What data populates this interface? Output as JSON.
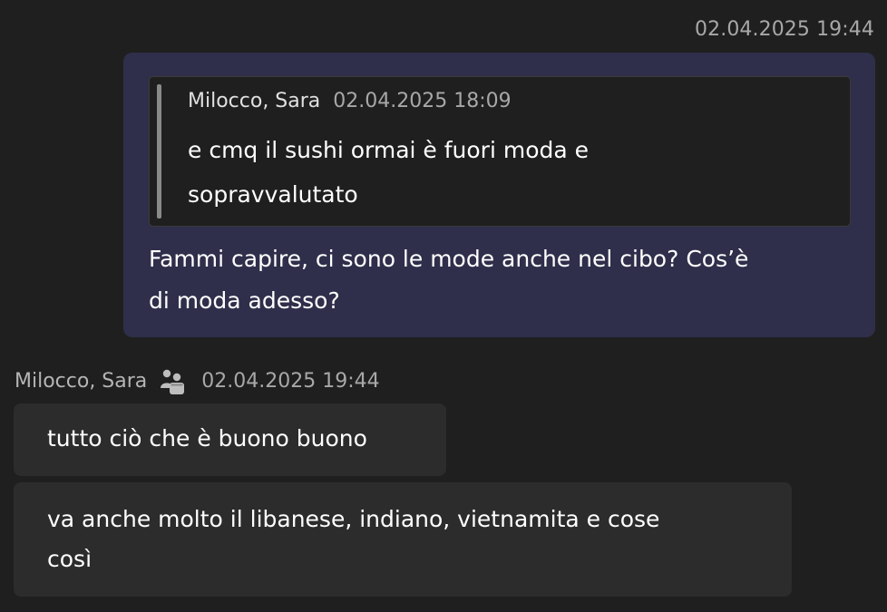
{
  "sent_message": {
    "timestamp": "02.04.2025 19:44",
    "quote": {
      "author": "Milocco, Sara",
      "timestamp": "02.04.2025 18:09",
      "text_line1": "e cmq il sushi ormai è fuori moda e",
      "text_line2": "sopravvalutato"
    },
    "text_line1": "Fammi capire, ci sono le mode anche nel cibo? Cos’è",
    "text_line2": "di moda adesso?"
  },
  "received_group": {
    "author": "Milocco, Sara",
    "author_icon": "external-user-icon",
    "timestamp": "02.04.2025 19:44",
    "messages": [
      {
        "text_line1": "tutto ciò che è buono buono"
      },
      {
        "text_line1": "va anche molto il libanese, indiano, vietnamita e cose",
        "text_line2": "così"
      }
    ]
  },
  "colors": {
    "background": "#1f1f1f",
    "sent_bubble": "#2f2f4b",
    "received_bubble": "#2c2c2c",
    "quote_background": "#1f1f1f",
    "text": "#ffffff",
    "muted_text": "#a8a8a8"
  }
}
